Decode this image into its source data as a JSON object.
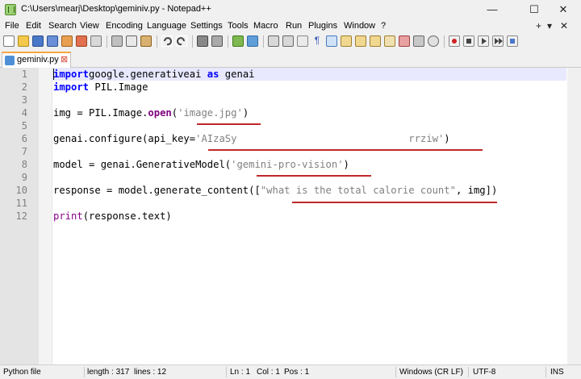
{
  "window": {
    "title": "C:\\Users\\mearj\\Desktop\\geminiv.py - Notepad++",
    "minimize": "—",
    "maximize": "☐",
    "close": "✕"
  },
  "menu": {
    "items": [
      "File",
      "Edit",
      "Search",
      "View",
      "Encoding",
      "Language",
      "Settings",
      "Tools",
      "Macro",
      "Run",
      "Plugins",
      "Window",
      "?"
    ],
    "add_tab": "+",
    "tab_list": "▾",
    "close_doc": "✕"
  },
  "tabs": [
    {
      "label": "geminiv.py",
      "close": "⊠"
    }
  ],
  "editor": {
    "line_numbers": [
      "1",
      "2",
      "3",
      "4",
      "5",
      "6",
      "7",
      "8",
      "9",
      "10",
      "11",
      "12"
    ],
    "lines": [
      {
        "parts": [
          [
            "kw",
            "import"
          ],
          [
            "",
            "google.generativeai "
          ],
          [
            "kw",
            "as"
          ],
          [
            "",
            " genai"
          ]
        ]
      },
      {
        "parts": [
          [
            "kw",
            "import"
          ],
          [
            "",
            " PIL.Image"
          ]
        ]
      },
      {
        "parts": []
      },
      {
        "parts": [
          [
            "",
            "img = PIL.Image."
          ],
          [
            "fn",
            "open"
          ],
          [
            "",
            "("
          ],
          [
            "str",
            "'image.jpg'"
          ],
          [
            "",
            ")"
          ]
        ]
      },
      {
        "parts": []
      },
      {
        "parts": [
          [
            "",
            "genai.configure(api_key="
          ],
          [
            "str",
            "'AIzaSy                             rrziw'"
          ],
          [
            "",
            ")"
          ]
        ]
      },
      {
        "parts": []
      },
      {
        "parts": [
          [
            "",
            "model = genai.GenerativeModel("
          ],
          [
            "str",
            "'gemini-pro-vision'"
          ],
          [
            "",
            ")"
          ]
        ]
      },
      {
        "parts": []
      },
      {
        "parts": [
          [
            "",
            "response = model.generate_content(["
          ],
          [
            "str",
            "\"what is the total calorie count\""
          ],
          [
            "",
            ", img])"
          ]
        ]
      },
      {
        "parts": []
      },
      {
        "parts": [
          [
            "kw2",
            "print"
          ],
          [
            "",
            "(response.text)"
          ]
        ]
      }
    ]
  },
  "status": {
    "language": "Python file",
    "length": "length : 317",
    "lines": "lines : 12",
    "ln": "Ln : 1",
    "col": "Col : 1",
    "pos": "Pos : 1",
    "eol": "Windows (CR LF)",
    "encoding": "UTF-8",
    "mode": "INS"
  },
  "colors": {
    "keyword": "#0000ff",
    "string": "#808080",
    "function": "#800080",
    "annotation_underline": "#c0282a",
    "tab_accent": "#f5a742"
  }
}
